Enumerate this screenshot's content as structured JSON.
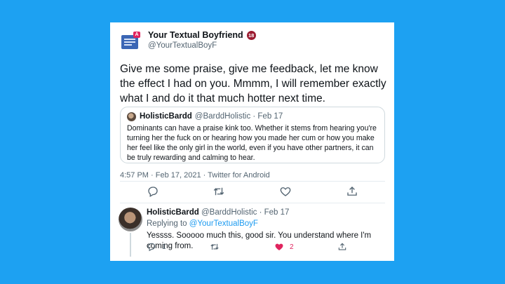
{
  "tweet": {
    "display_name": "Your Textual Boyfriend",
    "badge": "18",
    "handle": "@YourTextualBoyF",
    "avatar_bubble": "A",
    "text": "Give me some praise, give me feedback, let me know the effect I had on you. Mmmm, I will remember exactly what I and do it that much hotter next time.",
    "meta": "4:57 PM · Feb 17, 2021 · Twitter for Android"
  },
  "quote": {
    "display_name": "HolisticBardd",
    "handle_time": "@BarddHolistic · Feb 17",
    "text": "Dominants can have a praise kink too. Whether it stems from hearing you're turning her the fuck on or hearing how you made her cum or how you make her feel like the only girl in the world, even if you have other partners, it can be truly rewarding and calming to hear."
  },
  "actions": {
    "icons": [
      "reply-icon",
      "retweet-icon",
      "like-icon",
      "share-icon"
    ]
  },
  "reply": {
    "display_name": "HolisticBardd",
    "handle_time": "@BarddHolistic · Feb 17",
    "replying_prefix": "Replying to ",
    "replying_handle": "@YourTextualBoyF",
    "text": "Yessss. Sooooo much this, good sir. You understand where I'm coming from.",
    "reply_count": "1",
    "retweet_count": "",
    "like_count": "2"
  },
  "colors": {
    "background": "#1da1f2",
    "like_active": "#e0245e",
    "link": "#1d9bf0"
  }
}
